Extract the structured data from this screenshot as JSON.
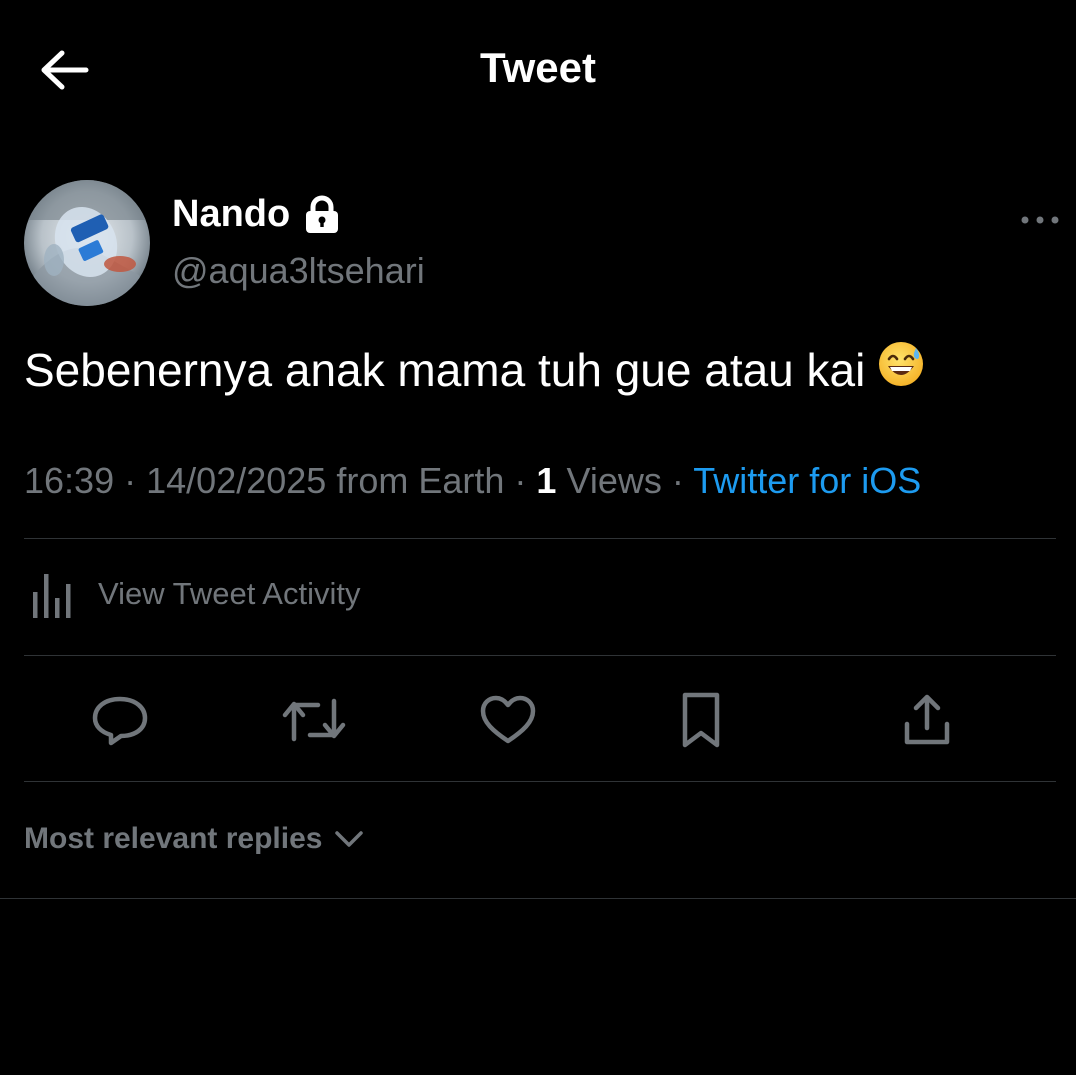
{
  "header": {
    "title": "Tweet",
    "back_icon": "arrow-left-icon"
  },
  "author": {
    "name": "Nando",
    "handle": "@aqua3ltsehari",
    "protected_icon": "lock-icon",
    "avatar": "water-bottle-photo"
  },
  "tweet": {
    "text": "Sebenernya anak mama tuh gue atau kai",
    "emoji": "grinning-face-with-sweat-emoji"
  },
  "meta": {
    "time": "16:39",
    "date": "14/02/2025",
    "location": "from Earth",
    "views_count": "1",
    "views_label": "Views",
    "source": "Twitter for iOS",
    "separator": "·"
  },
  "activity": {
    "label": "View Tweet Activity",
    "icon": "bar-chart-icon"
  },
  "actions": [
    {
      "name": "reply",
      "icon": "reply-bubble-icon"
    },
    {
      "name": "retweet",
      "icon": "retweet-icon"
    },
    {
      "name": "like",
      "icon": "heart-icon"
    },
    {
      "name": "bookmark",
      "icon": "bookmark-icon"
    },
    {
      "name": "share",
      "icon": "share-icon"
    }
  ],
  "replies": {
    "sort_label": "Most relevant replies",
    "chevron_icon": "chevron-down-icon"
  },
  "colors": {
    "background": "#000000",
    "text_primary": "#ffffff",
    "text_secondary": "#71767b",
    "accent": "#1d9bf0",
    "divider": "#2f3336"
  }
}
